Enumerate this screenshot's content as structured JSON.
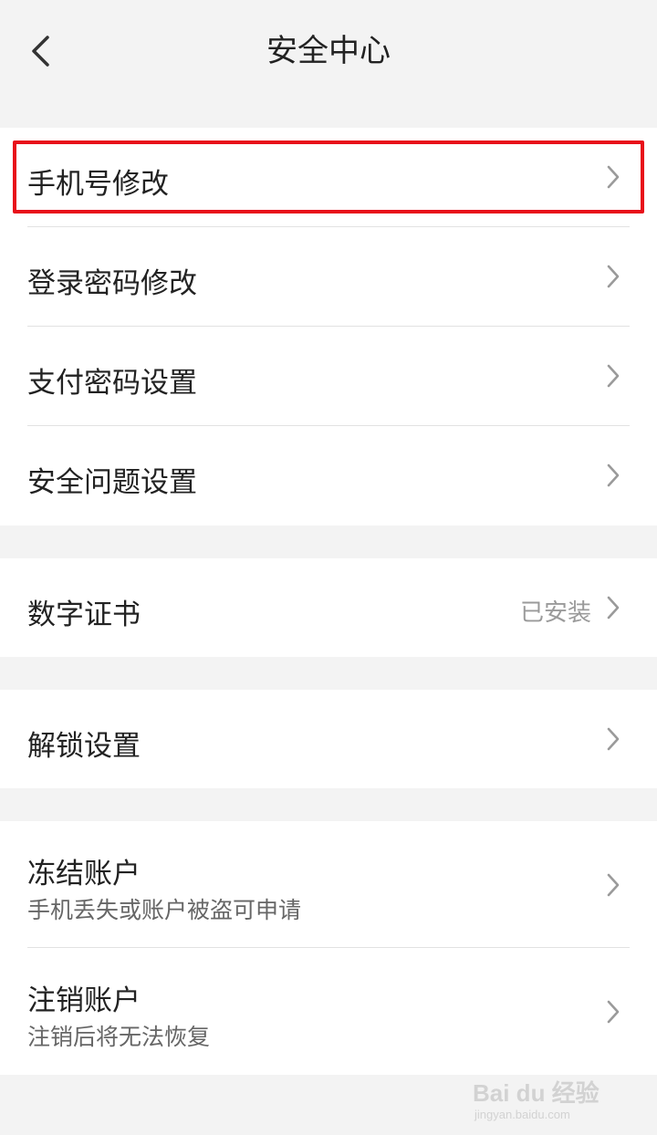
{
  "header": {
    "title": "安全中心",
    "back_icon": "chevron-left-icon"
  },
  "groups": {
    "account": [
      {
        "label": "手机号修改"
      },
      {
        "label": "登录密码修改"
      },
      {
        "label": "支付密码设置"
      },
      {
        "label": "安全问题设置"
      }
    ],
    "certificate": {
      "label": "数字证书",
      "value": "已安装"
    },
    "unlock": {
      "label": "解锁设置"
    },
    "danger": [
      {
        "label": "冻结账户",
        "sub": "手机丢失或账户被盗可申请"
      },
      {
        "label": "注销账户",
        "sub": "注销后将无法恢复"
      }
    ]
  },
  "watermark": {
    "text": "Bai du 经验",
    "sub": "jingyan.baidu.com"
  },
  "colors": {
    "background": "#f3f3f3",
    "card": "#ffffff",
    "highlight": "#e8101a",
    "chevron": "#9a9a9a"
  }
}
